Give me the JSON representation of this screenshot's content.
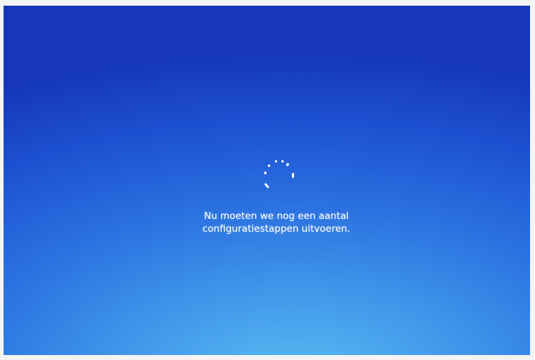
{
  "setup_screen": {
    "message_line_1": "Nu moeten we nog een aantal",
    "message_line_2": "configuratiestappen uitvoeren.",
    "spinner_icon": "loading-dots-spinner-icon",
    "colors": {
      "background_top": "#1537b8",
      "background_bottom": "#5cbdf2",
      "text": "#ffffff"
    }
  }
}
